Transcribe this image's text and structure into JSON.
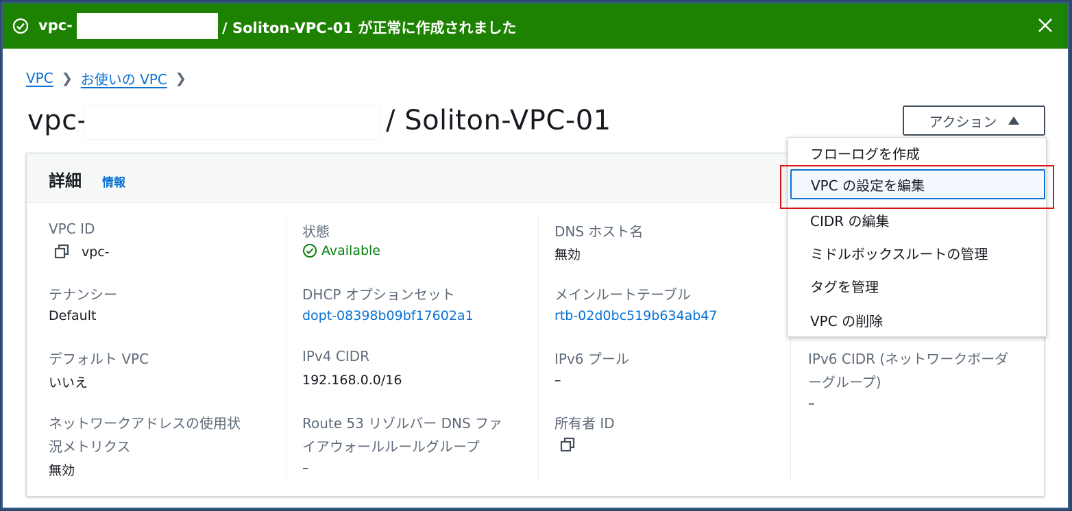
{
  "banner": {
    "prefix": "vpc-",
    "suffix": "/ Soliton-VPC-01 が正常に作成されました"
  },
  "breadcrumb": {
    "items": [
      "VPC",
      "お使いの VPC"
    ]
  },
  "title": {
    "prefix": "vpc-",
    "suffix": "/ Soliton-VPC-01"
  },
  "actions": {
    "label": "アクション",
    "menu": [
      "フローログを作成",
      "VPC の設定を編集",
      "CIDR の編集",
      "ミドルボックスルートの管理",
      "タグを管理",
      "VPC の削除"
    ]
  },
  "details": {
    "title": "詳細",
    "info": "情報",
    "col1": {
      "vpc_id_label": "VPC ID",
      "vpc_id_value": "vpc-",
      "tenancy_label": "テナンシー",
      "tenancy_value": "Default",
      "default_vpc_label": "デフォルト VPC",
      "default_vpc_value": "いいえ",
      "metrics_label_1": "ネットワークアドレスの使用状",
      "metrics_label_2": "況メトリクス",
      "metrics_value": "無効"
    },
    "col2": {
      "state_label": "状態",
      "state_value": "Available",
      "dhcp_label": "DHCP オプションセット",
      "dhcp_value": "dopt-08398b09bf17602a1",
      "ipv4_label": "IPv4 CIDR",
      "ipv4_value": "192.168.0.0/16",
      "route53_label_1": "Route 53 リゾルバー DNS ファ",
      "route53_label_2": "イアウォールルールグループ",
      "route53_value": "–"
    },
    "col3": {
      "dns_host_label": "DNS ホスト名",
      "dns_host_value": "無効",
      "main_rt_label": "メインルートテーブル",
      "main_rt_value": "rtb-02d0bc519b634ab47",
      "ipv6_pool_label": "IPv6 プール",
      "ipv6_pool_value": "–",
      "owner_label": "所有者 ID"
    },
    "col4": {
      "ipv6_cidr_label_1": "IPv6 CIDR (ネットワークボーダ",
      "ipv6_cidr_label_2": "ーグループ)",
      "ipv6_cidr_value": "–"
    }
  },
  "colors": {
    "success": "#1d8102",
    "link": "#0972d3",
    "available": "#037f0c",
    "highlight_border": "#d91515"
  }
}
